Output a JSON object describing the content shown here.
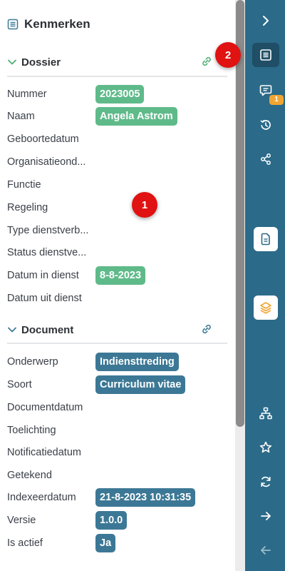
{
  "panel": {
    "title": "Kenmerken",
    "header_icon": "document-lines-icon"
  },
  "dossier": {
    "title": "Dossier",
    "fields": [
      {
        "label": "Nummer",
        "value": "2023005"
      },
      {
        "label": "Naam",
        "value": "Angela Astrom"
      },
      {
        "label": "Geboortedatum",
        "value": ""
      },
      {
        "label": "Organisatieond...",
        "value": ""
      },
      {
        "label": "Functie",
        "value": ""
      },
      {
        "label": "Regeling",
        "value": ""
      },
      {
        "label": "Type dienstverb...",
        "value": ""
      },
      {
        "label": "Status dienstve...",
        "value": ""
      },
      {
        "label": "Datum in dienst",
        "value": "8-8-2023"
      },
      {
        "label": "Datum uit dienst",
        "value": ""
      }
    ]
  },
  "document": {
    "title": "Document",
    "fields": [
      {
        "label": "Onderwerp",
        "value": "Indiensttreding"
      },
      {
        "label": "Soort",
        "value": "Curriculum vitae"
      },
      {
        "label": "Documentdatum",
        "value": ""
      },
      {
        "label": "Toelichting",
        "value": ""
      },
      {
        "label": "Notificatiedatum",
        "value": ""
      },
      {
        "label": "Getekend",
        "value": ""
      },
      {
        "label": "Indexeerdatum",
        "value": "21-8-2023 10:31:35"
      },
      {
        "label": "Versie",
        "value": "1.0.0"
      },
      {
        "label": "Is actief",
        "value": "Ja"
      }
    ]
  },
  "rail": {
    "badge_count": "1",
    "buttons": [
      "chevron-right-icon",
      "document-lines-icon",
      "comment-icon",
      "history-icon",
      "share-icon",
      "file-icon",
      "layers-icon",
      "sitemap-icon",
      "star-icon",
      "refresh-icon",
      "arrow-right-icon",
      "arrow-left-icon"
    ]
  },
  "markers": {
    "one": "1",
    "two": "2"
  },
  "colors": {
    "rail": "#2b6a89",
    "chip_green": "#5fba8a",
    "chip_blue": "#3c7895",
    "badge": "#f0a532",
    "marker": "#e01212",
    "link_green": "#4caf73",
    "link_blue": "#3c7895"
  }
}
